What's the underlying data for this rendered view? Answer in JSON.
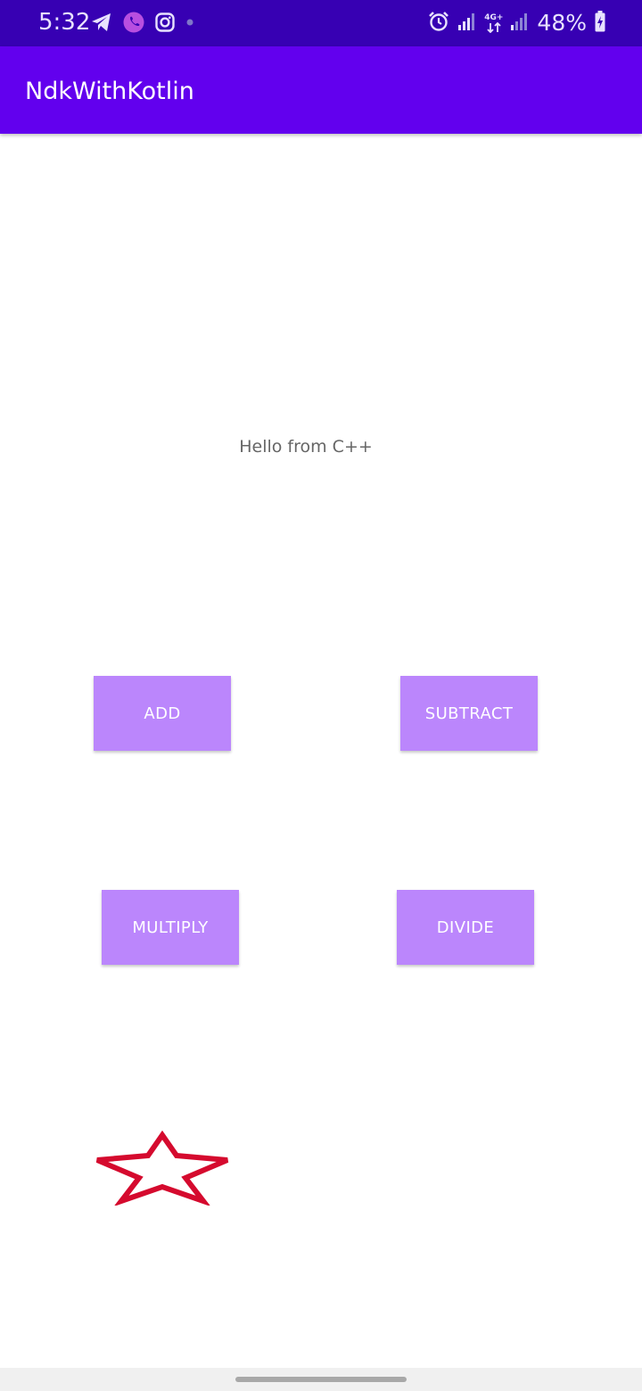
{
  "status_bar": {
    "time": "5:32",
    "network": "4G+",
    "battery_percent": "48%",
    "left_icons": [
      "telegram-icon",
      "viber-icon",
      "instagram-icon",
      "notification-dot-icon"
    ],
    "right_icons": [
      "alarm-icon",
      "signal-icon",
      "signal-icon",
      "battery-charging-icon"
    ]
  },
  "app_bar": {
    "title": "NdkWithKotlin"
  },
  "main": {
    "message": "Hello from C++",
    "buttons": {
      "add": "ADD",
      "subtract": "SUBTRACT",
      "multiply": "MULTIPLY",
      "divide": "DIVIDE"
    },
    "star_icon": "star-outline-icon"
  },
  "colors": {
    "status_bar": "#3700b3",
    "app_bar": "#6200ee",
    "button": "#bb86fc",
    "star": "#d50a2e"
  }
}
